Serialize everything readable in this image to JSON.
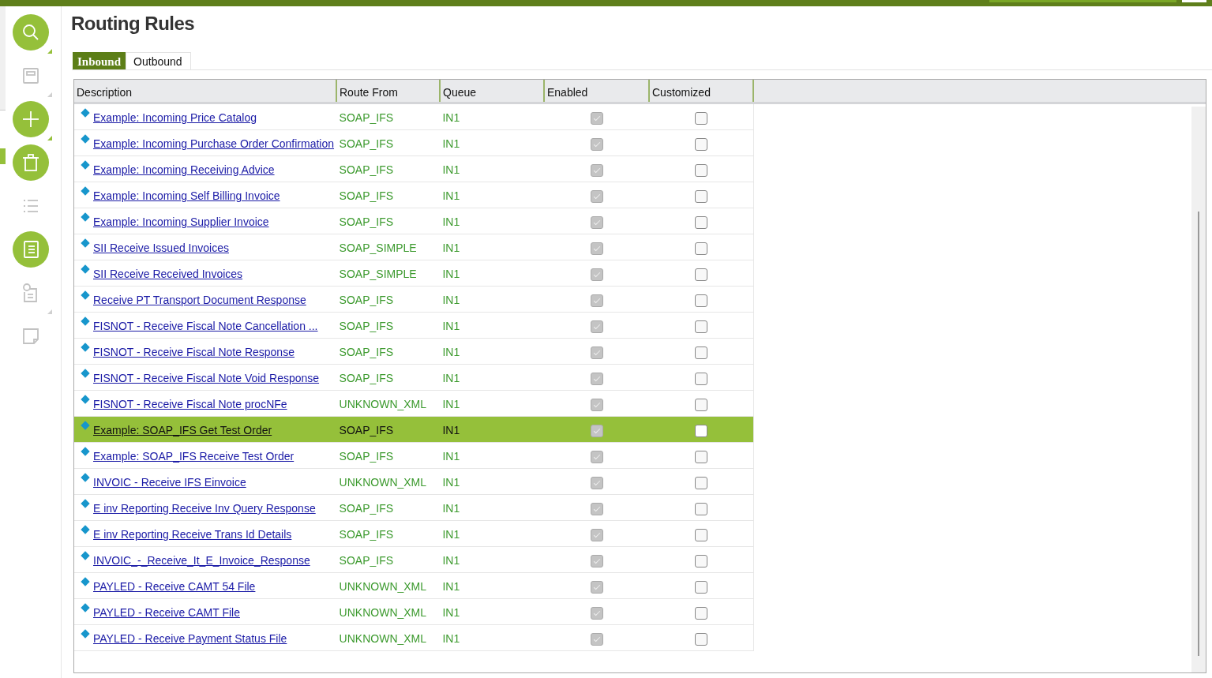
{
  "title": "Routing Rules",
  "sidebar": [
    {
      "kind": "search",
      "enabled": true
    },
    {
      "kind": "save",
      "enabled": false
    },
    {
      "kind": "add",
      "enabled": true
    },
    {
      "kind": "delete",
      "enabled": true
    },
    {
      "kind": "list",
      "enabled": false
    },
    {
      "kind": "details",
      "enabled": true
    },
    {
      "kind": "info",
      "enabled": false
    },
    {
      "kind": "note",
      "enabled": false
    }
  ],
  "tabs": [
    {
      "label": "Inbound",
      "selected": true
    },
    {
      "label": "Outbound",
      "selected": false
    }
  ],
  "table": {
    "columns": [
      "Description",
      "Route From",
      "Queue",
      "Enabled",
      "Customized"
    ],
    "rows": [
      {
        "description": "Example: Incoming Price Catalog",
        "route_from": "SOAP_IFS",
        "queue": "IN1",
        "enabled": true,
        "customized": false,
        "selected": false
      },
      {
        "description": "Example: Incoming Purchase Order Confirmation",
        "route_from": "SOAP_IFS",
        "queue": "IN1",
        "enabled": true,
        "customized": false,
        "selected": false
      },
      {
        "description": "Example: Incoming Receiving Advice",
        "route_from": "SOAP_IFS",
        "queue": "IN1",
        "enabled": true,
        "customized": false,
        "selected": false
      },
      {
        "description": "Example: Incoming Self Billing Invoice",
        "route_from": "SOAP_IFS",
        "queue": "IN1",
        "enabled": true,
        "customized": false,
        "selected": false
      },
      {
        "description": "Example: Incoming Supplier Invoice",
        "route_from": "SOAP_IFS",
        "queue": "IN1",
        "enabled": true,
        "customized": false,
        "selected": false
      },
      {
        "description": "SII Receive Issued Invoices",
        "route_from": "SOAP_SIMPLE",
        "queue": "IN1",
        "enabled": true,
        "customized": false,
        "selected": false
      },
      {
        "description": "SII Receive Received Invoices",
        "route_from": "SOAP_SIMPLE",
        "queue": "IN1",
        "enabled": true,
        "customized": false,
        "selected": false
      },
      {
        "description": "Receive PT Transport Document Response",
        "route_from": "SOAP_IFS",
        "queue": "IN1",
        "enabled": true,
        "customized": false,
        "selected": false
      },
      {
        "description": "FISNOT - Receive Fiscal Note Cancellation ...",
        "route_from": "SOAP_IFS",
        "queue": "IN1",
        "enabled": true,
        "customized": false,
        "selected": false
      },
      {
        "description": "FISNOT - Receive Fiscal Note Response",
        "route_from": "SOAP_IFS",
        "queue": "IN1",
        "enabled": true,
        "customized": false,
        "selected": false
      },
      {
        "description": "FISNOT - Receive Fiscal Note Void Response",
        "route_from": "SOAP_IFS",
        "queue": "IN1",
        "enabled": true,
        "customized": false,
        "selected": false
      },
      {
        "description": "FISNOT - Receive Fiscal Note procNFe",
        "route_from": "UNKNOWN_XML",
        "queue": "IN1",
        "enabled": true,
        "customized": false,
        "selected": false
      },
      {
        "description": "Example: SOAP_IFS Get Test Order",
        "route_from": "SOAP_IFS",
        "queue": "IN1",
        "enabled": true,
        "customized": false,
        "selected": true
      },
      {
        "description": "Example: SOAP_IFS Receive Test Order",
        "route_from": "SOAP_IFS",
        "queue": "IN1",
        "enabled": true,
        "customized": false,
        "selected": false
      },
      {
        "description": "INVOIC - Receive IFS Einvoice",
        "route_from": "UNKNOWN_XML",
        "queue": "IN1",
        "enabled": true,
        "customized": false,
        "selected": false
      },
      {
        "description": "E inv Reporting Receive Inv Query Response",
        "route_from": "SOAP_IFS",
        "queue": "IN1",
        "enabled": true,
        "customized": false,
        "selected": false
      },
      {
        "description": "E inv Reporting Receive Trans Id Details",
        "route_from": "SOAP_IFS",
        "queue": "IN1",
        "enabled": true,
        "customized": false,
        "selected": false
      },
      {
        "description": "INVOIC_-_Receive_It_E_Invoice_Response",
        "route_from": "SOAP_IFS",
        "queue": "IN1",
        "enabled": true,
        "customized": false,
        "selected": false
      },
      {
        "description": "PAYLED - Receive CAMT 54 File",
        "route_from": "UNKNOWN_XML",
        "queue": "IN1",
        "enabled": true,
        "customized": false,
        "selected": false
      },
      {
        "description": "PAYLED - Receive CAMT File",
        "route_from": "UNKNOWN_XML",
        "queue": "IN1",
        "enabled": true,
        "customized": false,
        "selected": false
      },
      {
        "description": "PAYLED - Receive Payment Status File",
        "route_from": "UNKNOWN_XML",
        "queue": "IN1",
        "enabled": true,
        "customized": false,
        "selected": false
      }
    ]
  }
}
